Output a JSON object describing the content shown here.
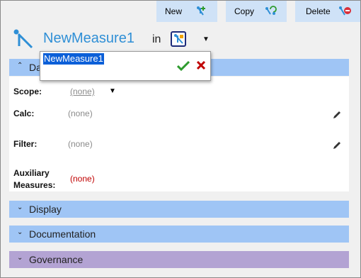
{
  "toolbar": {
    "new_label": "New",
    "copy_label": "Copy",
    "delete_label": "Delete"
  },
  "header": {
    "title": "NewMeasure1",
    "in_label": "in"
  },
  "rename_popup": {
    "value": "NewMeasure1"
  },
  "sections": {
    "details": {
      "label": "Details",
      "visible_label": "Da",
      "expanded": true
    },
    "display": {
      "label": "Display",
      "expanded": false
    },
    "documentation": {
      "label": "Documentation",
      "expanded": false
    },
    "governance": {
      "label": "Governance",
      "expanded": false
    }
  },
  "fields": {
    "scope": {
      "label": "Scope:",
      "value": "(none)"
    },
    "calc": {
      "label": "Calc:",
      "value": "(none)"
    },
    "filter": {
      "label": "Filter:",
      "value": "(none)"
    },
    "auxiliary": {
      "label_line1": "Auxiliary",
      "label_line2": "Measures:",
      "value": "(none)"
    }
  },
  "colors": {
    "accent": "#2f8fd6",
    "section_blue": "#9fc5f5",
    "section_purple": "#b3a3d3",
    "toolbar_button": "#cfe2f7",
    "danger": "#c00000",
    "ok_green": "#2e9b2e"
  },
  "icons": {
    "measure": "measure-icon",
    "new": "new-plus-icon",
    "copy": "copy-icon",
    "delete": "delete-icon",
    "folder": "measure-folder-icon",
    "pencil": "pencil-icon",
    "check": "check-icon",
    "close": "close-icon"
  }
}
